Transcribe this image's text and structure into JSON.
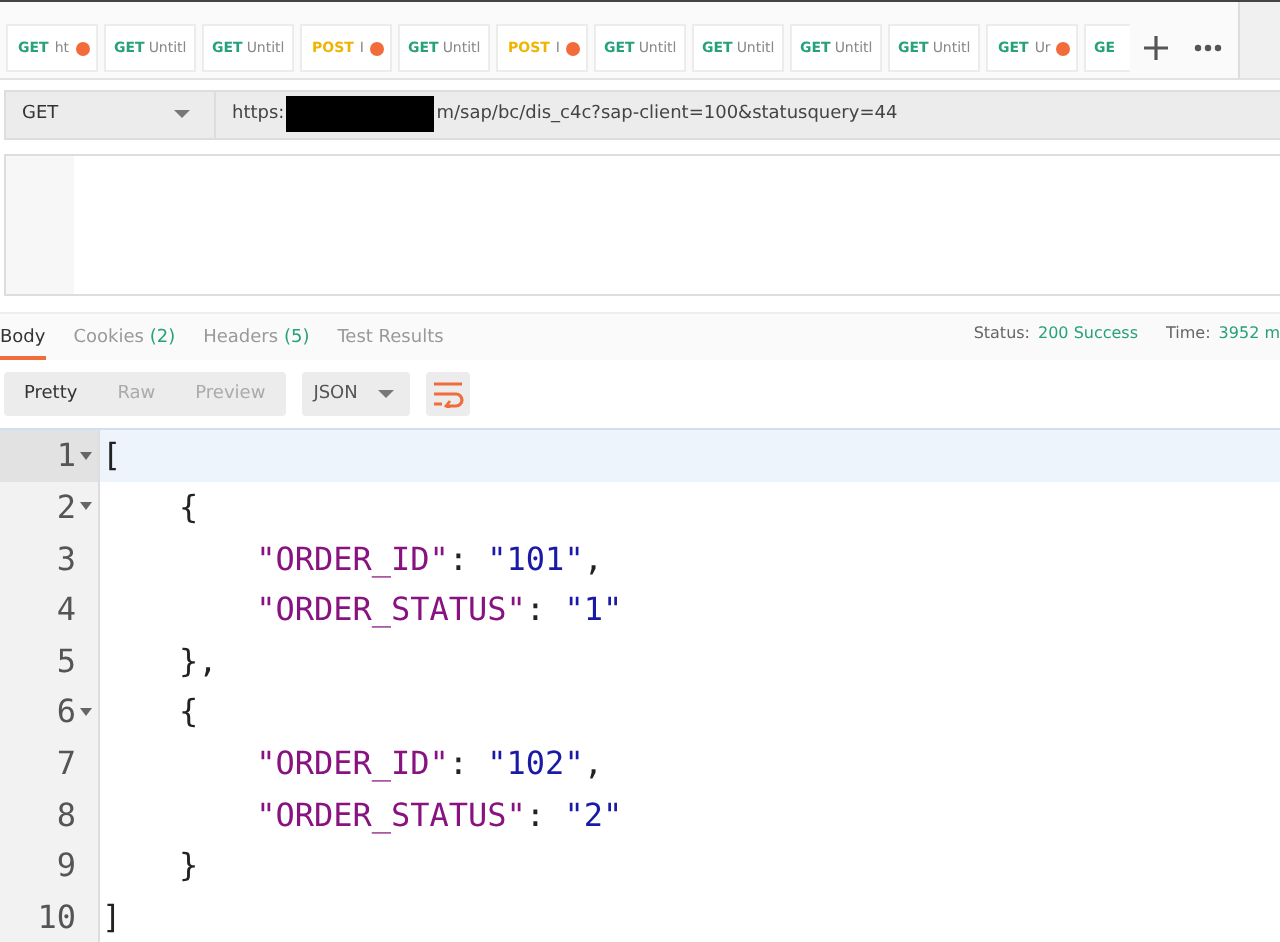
{
  "request_tabs": [
    {
      "method": "GET",
      "title": "ht",
      "unsaved": true
    },
    {
      "method": "GET",
      "title": "Untitl",
      "unsaved": false
    },
    {
      "method": "GET",
      "title": "Untitl",
      "unsaved": false
    },
    {
      "method": "POST",
      "title": "I",
      "unsaved": true
    },
    {
      "method": "GET",
      "title": "Untitl",
      "unsaved": false
    },
    {
      "method": "POST",
      "title": "I",
      "unsaved": true
    },
    {
      "method": "GET",
      "title": "Untitl",
      "unsaved": false
    },
    {
      "method": "GET",
      "title": "Untitl",
      "unsaved": false
    },
    {
      "method": "GET",
      "title": "Untitl",
      "unsaved": false
    },
    {
      "method": "GET",
      "title": "Untitl",
      "unsaved": false
    },
    {
      "method": "GET",
      "title": "Ur",
      "unsaved": true
    },
    {
      "method": "GE",
      "unsaved": false
    }
  ],
  "request": {
    "method": "GET",
    "url_prefix": "https:",
    "url_redacted": true,
    "url_suffix": "m/sap/bc/dis_c4c?sap-client=100&statusquery=44"
  },
  "response_tabs": [
    {
      "label": "Body",
      "selected": true
    },
    {
      "label": "Cookies",
      "count": "(2)",
      "selected": false
    },
    {
      "label": "Headers",
      "count": "(5)",
      "selected": false
    },
    {
      "label": "Test Results",
      "selected": false
    }
  ],
  "status": {
    "label": "Status:",
    "value": "200 Success"
  },
  "time": {
    "label": "Time:",
    "value": "3952 m"
  },
  "view_modes": [
    {
      "label": "Pretty",
      "selected": true
    },
    {
      "label": "Raw",
      "selected": false
    },
    {
      "label": "Preview",
      "selected": false
    }
  ],
  "format": "JSON",
  "code_lines": [
    {
      "number": "1",
      "foldable": true,
      "active": true,
      "tokens": [
        {
          "kind": "punct",
          "text": "["
        }
      ]
    },
    {
      "number": "2",
      "foldable": true,
      "active": false,
      "tokens": [
        {
          "kind": "punct",
          "text": "    {"
        }
      ]
    },
    {
      "number": "3",
      "foldable": false,
      "active": false,
      "tokens": [
        {
          "kind": "key",
          "text": "        \"ORDER_ID\""
        },
        {
          "kind": "punct",
          "text": ": "
        },
        {
          "kind": "string",
          "text": "\"101\""
        },
        {
          "kind": "punct",
          "text": ","
        }
      ]
    },
    {
      "number": "4",
      "foldable": false,
      "active": false,
      "tokens": [
        {
          "kind": "key",
          "text": "        \"ORDER_STATUS\""
        },
        {
          "kind": "punct",
          "text": ": "
        },
        {
          "kind": "string",
          "text": "\"1\""
        }
      ]
    },
    {
      "number": "5",
      "foldable": false,
      "active": false,
      "tokens": [
        {
          "kind": "punct",
          "text": "    },"
        }
      ]
    },
    {
      "number": "6",
      "foldable": true,
      "active": false,
      "tokens": [
        {
          "kind": "punct",
          "text": "    {"
        }
      ]
    },
    {
      "number": "7",
      "foldable": false,
      "active": false,
      "tokens": [
        {
          "kind": "key",
          "text": "        \"ORDER_ID\""
        },
        {
          "kind": "punct",
          "text": ": "
        },
        {
          "kind": "string",
          "text": "\"102\""
        },
        {
          "kind": "punct",
          "text": ","
        }
      ]
    },
    {
      "number": "8",
      "foldable": false,
      "active": false,
      "tokens": [
        {
          "kind": "key",
          "text": "        \"ORDER_STATUS\""
        },
        {
          "kind": "punct",
          "text": ": "
        },
        {
          "kind": "string",
          "text": "\"2\""
        }
      ]
    },
    {
      "number": "9",
      "foldable": false,
      "active": false,
      "tokens": [
        {
          "kind": "punct",
          "text": "    }"
        }
      ]
    },
    {
      "number": "10",
      "foldable": false,
      "active": false,
      "tokens": [
        {
          "kind": "punct",
          "text": "]"
        }
      ]
    }
  ]
}
